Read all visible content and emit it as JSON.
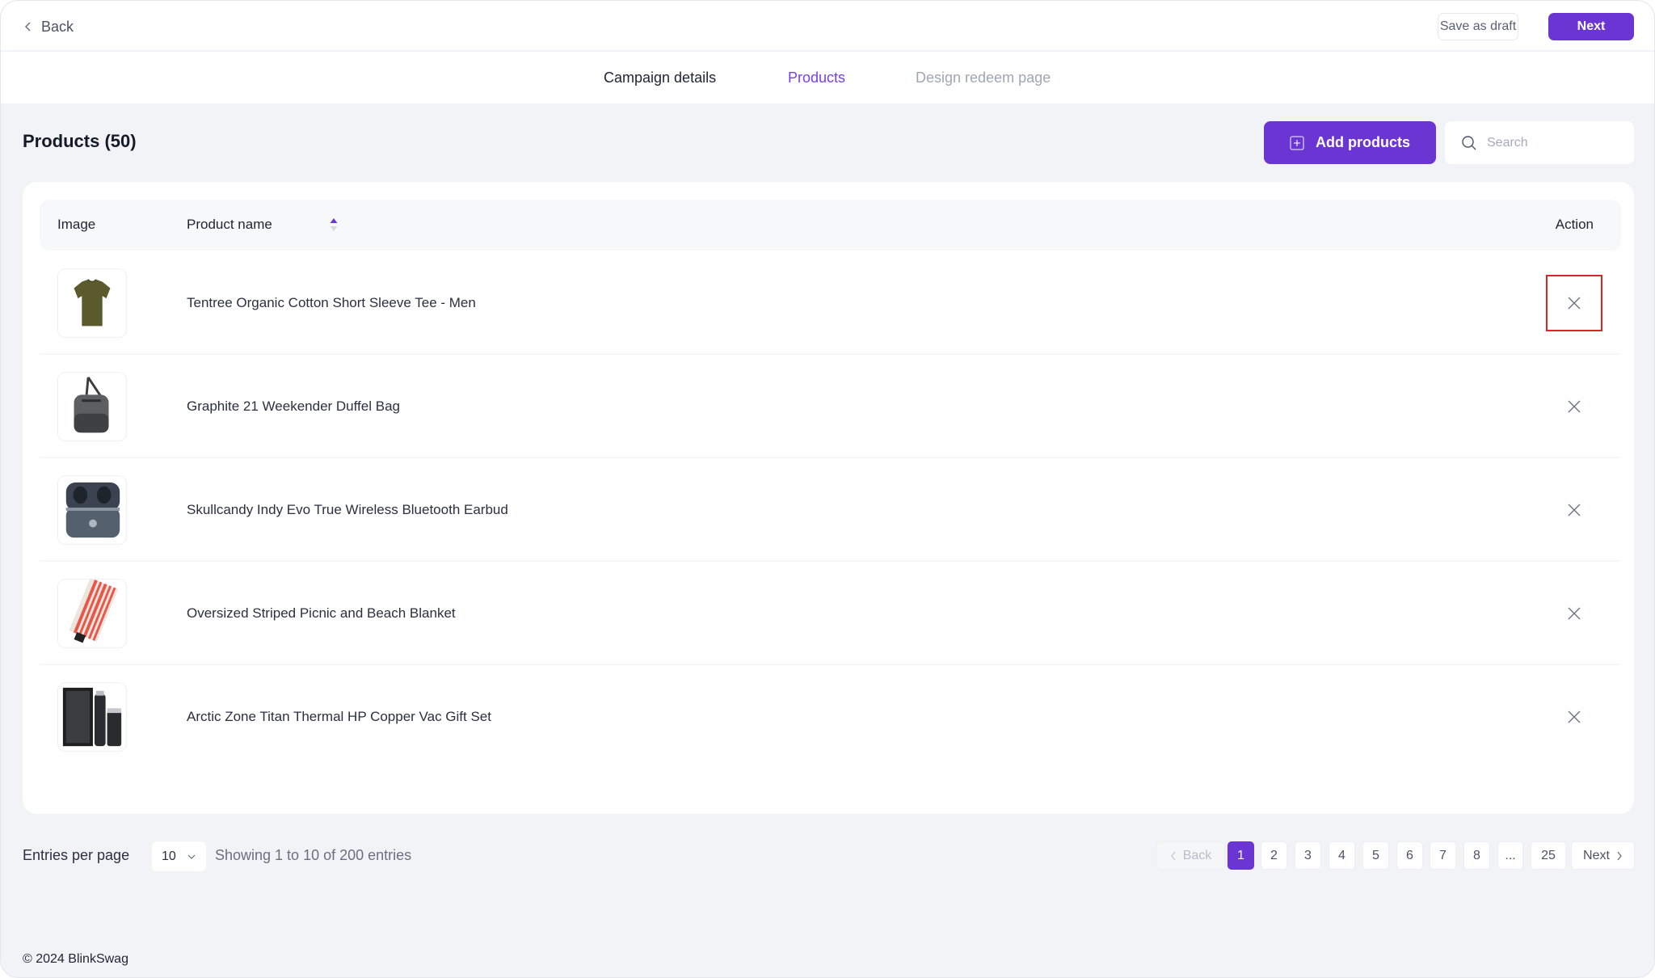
{
  "topbar": {
    "back_label": "Back",
    "save_draft_label": "Save as draft",
    "next_label": "Next"
  },
  "steps": [
    {
      "label": "Campaign details",
      "state": "done"
    },
    {
      "label": "Products",
      "state": "active"
    },
    {
      "label": "Design redeem page",
      "state": "upcoming"
    }
  ],
  "products_header": {
    "title": "Products (50)",
    "add_label": "Add products",
    "search_placeholder": "Search",
    "search_value": ""
  },
  "table": {
    "columns": {
      "image": "Image",
      "name": "Product name",
      "action": "Action"
    },
    "sort": {
      "column": "Product name",
      "direction": "ascending"
    },
    "rows": [
      {
        "name": "Tentree Organic Cotton Short Sleeve Tee - Men",
        "image_icon": "olive-tshirt-image",
        "highlighted_action": true
      },
      {
        "name": "Graphite 21 Weekender Duffel Bag",
        "image_icon": "grey-duffel-bag-image",
        "highlighted_action": false
      },
      {
        "name": "Skullcandy Indy Evo True Wireless Bluetooth Earbud",
        "image_icon": "earbuds-case-image",
        "highlighted_action": false
      },
      {
        "name": "Oversized Striped Picnic and Beach Blanket",
        "image_icon": "striped-blanket-image",
        "highlighted_action": false
      },
      {
        "name": "Arctic Zone Titan Thermal HP Copper Vac Gift Set",
        "image_icon": "thermal-gift-set-image",
        "highlighted_action": false
      }
    ]
  },
  "pagination": {
    "entries_label": "Entries per page",
    "entries_value": "10",
    "showing_text": "Showing 1 to 10 of 200 entries",
    "back_label": "Back",
    "next_label": "Next",
    "pages": [
      "1",
      "2",
      "3",
      "4",
      "5",
      "6",
      "7",
      "8",
      "...",
      "25"
    ],
    "current_page": "1"
  },
  "footer": {
    "copyright": "© 2024 BlinkSwag"
  },
  "colors": {
    "accent": "#6b35d4",
    "highlight_border": "#d9262b",
    "background": "#f2f3f7"
  }
}
